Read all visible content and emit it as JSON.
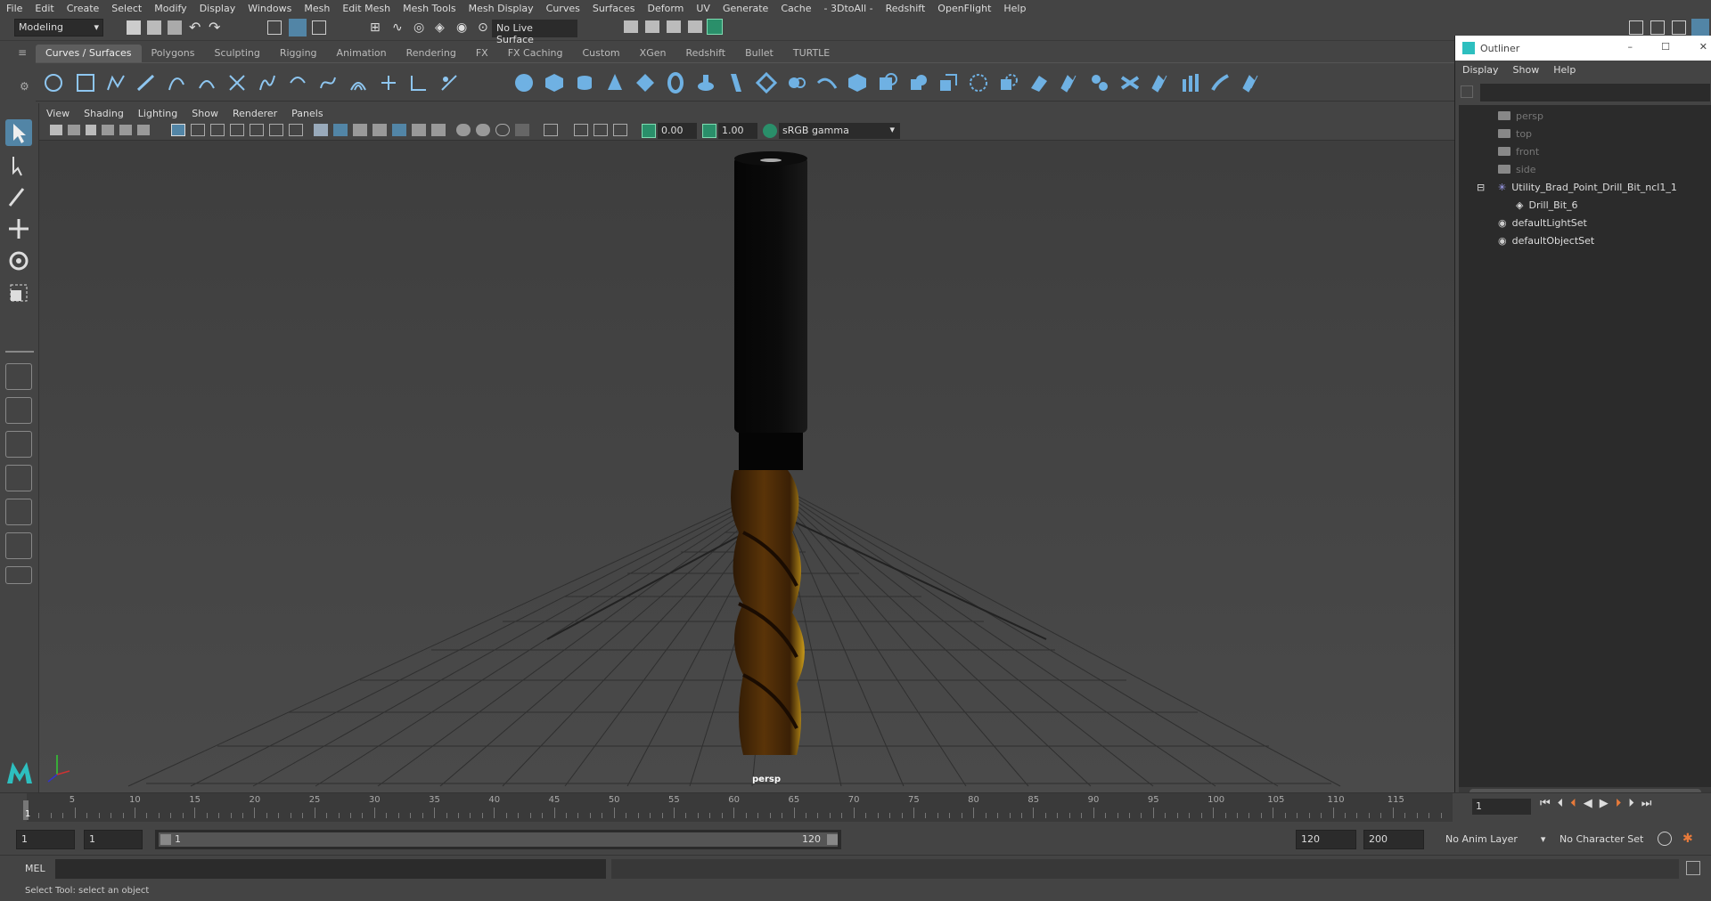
{
  "menubar": [
    "File",
    "Edit",
    "Create",
    "Select",
    "Modify",
    "Display",
    "Windows",
    "Mesh",
    "Edit Mesh",
    "Mesh Tools",
    "Mesh Display",
    "Curves",
    "Surfaces",
    "Deform",
    "UV",
    "Generate",
    "Cache",
    "- 3DtoAll -",
    "Redshift",
    "OpenFlight",
    "Help"
  ],
  "toolbar": {
    "workspace": "Modeling",
    "live_surface": "No Live Surface"
  },
  "shelf_tabs": [
    "Curves / Surfaces",
    "Polygons",
    "Sculpting",
    "Rigging",
    "Animation",
    "Rendering",
    "FX",
    "FX Caching",
    "Custom",
    "XGen",
    "Redshift",
    "Bullet",
    "TURTLE"
  ],
  "viewport": {
    "menu": [
      "View",
      "Shading",
      "Lighting",
      "Show",
      "Renderer",
      "Panels"
    ],
    "exposure": "0.00",
    "gamma": "1.00",
    "color_space": "sRGB gamma",
    "camera_label": "persp"
  },
  "outliner": {
    "title": "Outliner",
    "menu": [
      "Display",
      "Show",
      "Help"
    ],
    "items": [
      {
        "label": "persp",
        "dim": true,
        "indent": 44,
        "icon": "camera-icon"
      },
      {
        "label": "top",
        "dim": true,
        "indent": 44,
        "icon": "camera-icon"
      },
      {
        "label": "front",
        "dim": true,
        "indent": 44,
        "icon": "camera-icon"
      },
      {
        "label": "side",
        "dim": true,
        "indent": 44,
        "icon": "camera-icon"
      },
      {
        "label": "Utility_Brad_Point_Drill_Bit_ncl1_1",
        "dim": false,
        "indent": 44,
        "icon": "group-icon"
      },
      {
        "label": "Drill_Bit_6",
        "dim": false,
        "indent": 64,
        "icon": "mesh-icon"
      },
      {
        "label": "defaultLightSet",
        "dim": false,
        "indent": 44,
        "icon": "set-icon"
      },
      {
        "label": "defaultObjectSet",
        "dim": false,
        "indent": 44,
        "icon": "set-icon"
      }
    ]
  },
  "timeline": {
    "ticks": [
      "5",
      "10",
      "15",
      "20",
      "25",
      "30",
      "35",
      "40",
      "45",
      "50",
      "55",
      "60",
      "65",
      "70",
      "75",
      "80",
      "85",
      "90",
      "95",
      "100",
      "105",
      "110",
      "115"
    ],
    "current_frame": "1",
    "current_field": "1"
  },
  "range": {
    "start": "1",
    "playback_start": "1",
    "slider_start": "1",
    "slider_end": "120",
    "playback_end": "120",
    "end": "200",
    "anim_layer": "No Anim Layer",
    "character_set": "No Character Set"
  },
  "mel_label": "MEL",
  "status": "Select Tool: select an object"
}
